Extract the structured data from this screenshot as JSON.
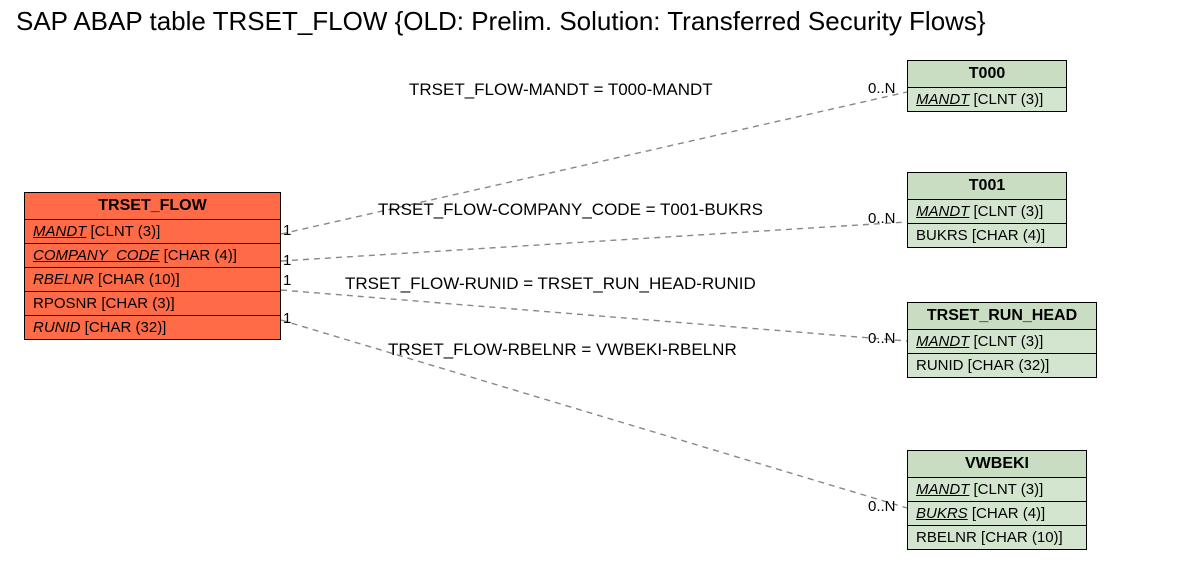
{
  "title": "SAP ABAP table TRSET_FLOW {OLD: Prelim. Solution: Transferred Security Flows}",
  "main_table": {
    "name": "TRSET_FLOW",
    "fields": {
      "f0": {
        "name": "MANDT",
        "type": "[CLNT (3)]"
      },
      "f1": {
        "name": "COMPANY_CODE",
        "type": "[CHAR (4)]"
      },
      "f2": {
        "name": "RBELNR",
        "type": "[CHAR (10)]"
      },
      "f3": {
        "name": "RPOSNR",
        "type": "[CHAR (3)]"
      },
      "f4": {
        "name": "RUNID",
        "type": "[CHAR (32)]"
      }
    }
  },
  "ref_tables": {
    "t000": {
      "name": "T000",
      "fields": {
        "f0": {
          "name": "MANDT",
          "type": "[CLNT (3)]"
        }
      }
    },
    "t001": {
      "name": "T001",
      "fields": {
        "f0": {
          "name": "MANDT",
          "type": "[CLNT (3)]"
        },
        "f1": {
          "name": "BUKRS",
          "type": "[CHAR (4)]"
        }
      }
    },
    "trset_run_head": {
      "name": "TRSET_RUN_HEAD",
      "fields": {
        "f0": {
          "name": "MANDT",
          "type": "[CLNT (3)]"
        },
        "f1": {
          "name": "RUNID",
          "type": "[CHAR (32)]"
        }
      }
    },
    "vwbeki": {
      "name": "VWBEKI",
      "fields": {
        "f0": {
          "name": "MANDT",
          "type": "[CLNT (3)]"
        },
        "f1": {
          "name": "BUKRS",
          "type": "[CHAR (4)]"
        },
        "f2": {
          "name": "RBELNR",
          "type": "[CHAR (10)]"
        }
      }
    }
  },
  "relations": {
    "r0": {
      "label": "TRSET_FLOW-MANDT = T000-MANDT",
      "left_card": "1",
      "right_card": "0..N"
    },
    "r1": {
      "label": "TRSET_FLOW-COMPANY_CODE = T001-BUKRS",
      "left_card": "1",
      "right_card": "0..N"
    },
    "r2": {
      "label": "TRSET_FLOW-RUNID = TRSET_RUN_HEAD-RUNID",
      "left_card": "1",
      "right_card": "0..N"
    },
    "r3": {
      "label": "TRSET_FLOW-RBELNR = VWBEKI-RBELNR",
      "left_card": "1",
      "right_card": "0..N"
    }
  }
}
